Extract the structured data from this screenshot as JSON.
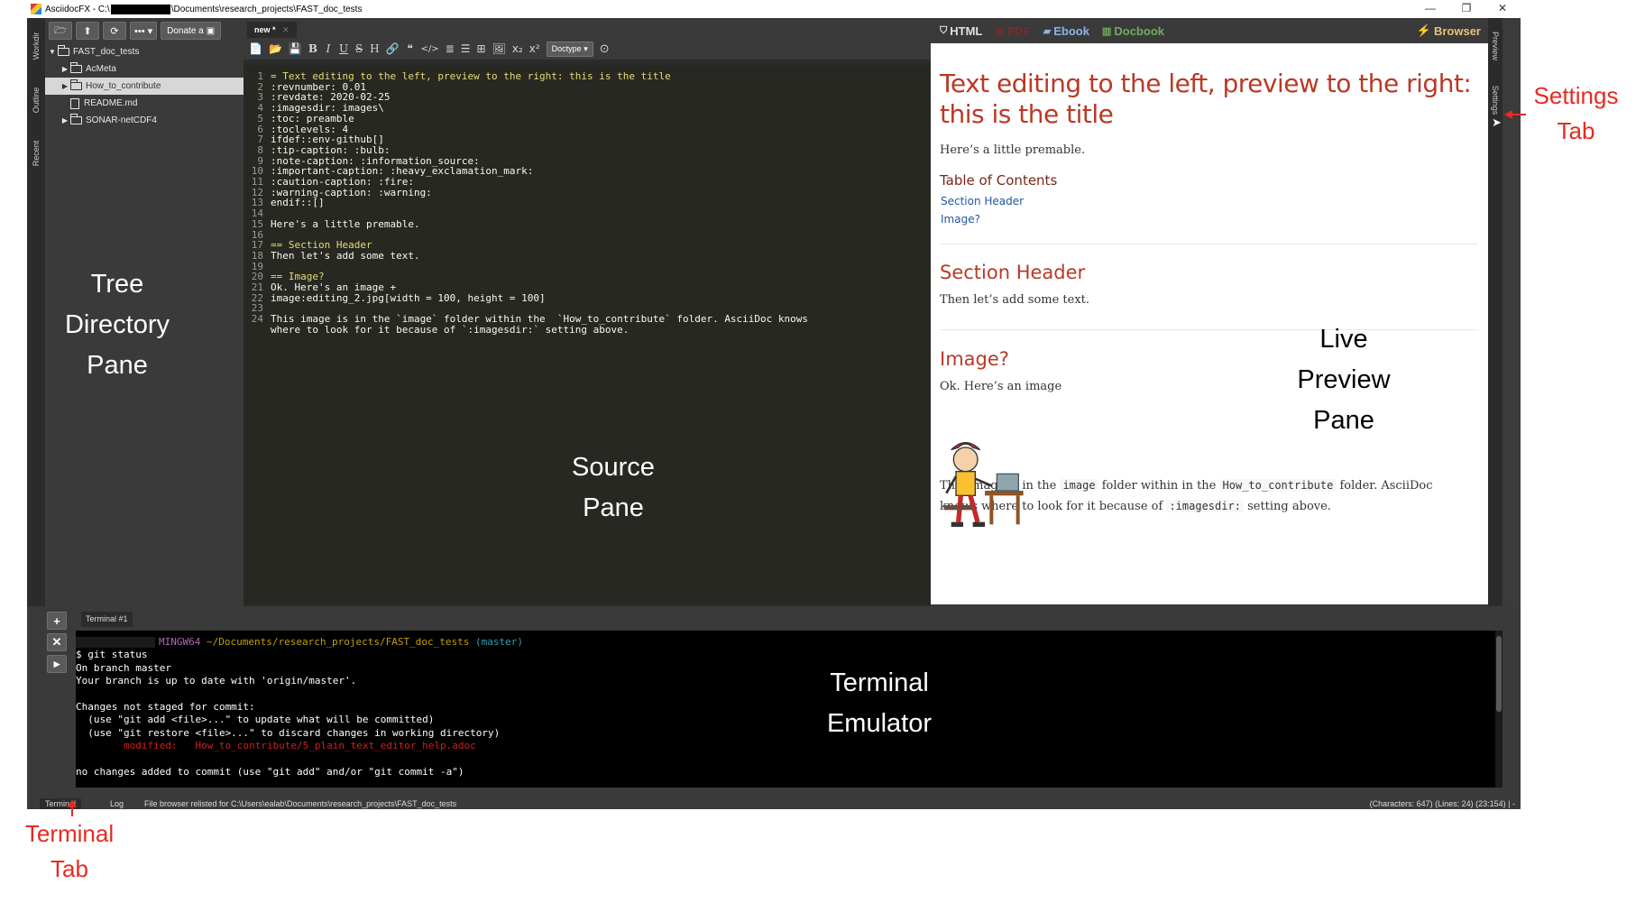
{
  "window": {
    "title_prefix": "AsciidocFX - C:\\",
    "title_suffix": "\\Documents\\research_projects\\FAST_doc_tests",
    "minimize": "—",
    "restore": "❐",
    "close": "✕"
  },
  "left_tabs": [
    "Workdir",
    "Outline",
    "Recent"
  ],
  "tree_toolbar": {
    "donate_label": "Donate a"
  },
  "tree": [
    {
      "label": "FAST_doc_tests",
      "arrow": "▼",
      "kind": "folder"
    },
    {
      "label": "AcMeta",
      "arrow": "▶",
      "kind": "folder"
    },
    {
      "label": "How_to_contribute",
      "arrow": "▶",
      "kind": "folder",
      "selected": true
    },
    {
      "label": "README.md",
      "arrow": "",
      "kind": "file"
    },
    {
      "label": "SONAR-netCDF4",
      "arrow": "▶",
      "kind": "folder"
    }
  ],
  "editor": {
    "tab_label": "new *",
    "tab_close": "✕",
    "doctype_label": "Doctype",
    "format_icons": [
      "📄",
      "📂",
      "💾",
      "B",
      "I",
      "U",
      "S",
      "H",
      "🔗",
      "❝",
      "</>",
      "≣",
      "☰",
      "⊞",
      "🖼",
      "x₂",
      "x²"
    ],
    "lines": [
      {
        "num": "1",
        "text": "= Text editing to the left, preview to the right: this is the title",
        "cls": "src-y"
      },
      {
        "num": "2",
        "text": ":revnumber: 0.01",
        "cls": "src-w"
      },
      {
        "num": "3",
        "text": ":revdate: 2020-02-25",
        "cls": "src-w"
      },
      {
        "num": "4",
        "text": ":imagesdir: images\\",
        "cls": "src-w"
      },
      {
        "num": "5",
        "text": ":toc: preamble",
        "cls": "src-w"
      },
      {
        "num": "6",
        "text": ":toclevels: 4",
        "cls": "src-w"
      },
      {
        "num": "7",
        "text": "ifdef::env-github[]",
        "cls": "src-w"
      },
      {
        "num": "8",
        "text": ":tip-caption: :bulb:",
        "cls": "src-w"
      },
      {
        "num": "9",
        "text": ":note-caption: :information_source:",
        "cls": "src-w"
      },
      {
        "num": "10",
        "text": ":important-caption: :heavy_exclamation_mark:",
        "cls": "src-w"
      },
      {
        "num": "11",
        "text": ":caution-caption: :fire:",
        "cls": "src-w"
      },
      {
        "num": "12",
        "text": ":warning-caption: :warning:",
        "cls": "src-w"
      },
      {
        "num": "13",
        "text": "endif::[]",
        "cls": "src-w"
      },
      {
        "num": "14",
        "text": "",
        "cls": "src-w"
      },
      {
        "num": "15",
        "text": "Here's a little premable.",
        "cls": "src-w"
      },
      {
        "num": "16",
        "text": "",
        "cls": "src-w"
      },
      {
        "num": "17",
        "text": "== Section Header",
        "cls": "src-y"
      },
      {
        "num": "18",
        "text": "Then let's add some text.",
        "cls": "src-w"
      },
      {
        "num": "19",
        "text": "",
        "cls": "src-w"
      },
      {
        "num": "20",
        "text": "== Image?",
        "cls": "src-y"
      },
      {
        "num": "21",
        "text": "Ok. Here's an image +",
        "cls": "src-w"
      },
      {
        "num": "22",
        "text": "image:editing_2.jpg[width = 100, height = 100]",
        "cls": "src-w"
      },
      {
        "num": "23",
        "text": "",
        "cls": "src-w"
      },
      {
        "num": "24",
        "text": "This image is in the `image` folder within the  `How_to_contribute` folder. AsciiDoc knows",
        "cls": "src-w"
      },
      {
        "num": "",
        "text": "where to look for it because of `:imagesdir:` setting above.",
        "cls": "src-w"
      }
    ]
  },
  "preview_header": {
    "html": "HTML",
    "pdf": "PDF",
    "ebook": "Ebook",
    "docbook": "Docbook",
    "browser": "Browser"
  },
  "right_tabs": [
    "Preview",
    "Settings"
  ],
  "preview": {
    "title": "Text editing to the left, preview to the right: this is the title",
    "premable": "Here’s a little premable.",
    "toc_title": "Table of Contents",
    "toc_items": [
      "Section Header",
      "Image?"
    ],
    "section1_title": "Section Header",
    "section1_text": "Then let’s add some text.",
    "section2_title": "Image?",
    "section2_text": "Ok. Here’s an image",
    "final_p1": "This image is in the",
    "final_code1": "image",
    "final_p2": "folder within in the",
    "final_code2": "How_to_contribute",
    "final_p3": "folder. AsciiDoc",
    "final_p4": "knows where to look for it because of",
    "final_code3": ":imagesdir:",
    "final_p5": "setting above."
  },
  "terminal": {
    "tab_label": "Terminal #1",
    "lines": [
      {
        "text": "MINGW64 ~/Documents/research_projects/FAST_doc_tests",
        "extra": " (master)",
        "cls": "prompt"
      },
      {
        "text": "$ git status",
        "cls": "w"
      },
      {
        "text": "On branch master",
        "cls": "w"
      },
      {
        "text": "Your branch is up to date with 'origin/master'.",
        "cls": "w"
      },
      {
        "text": "",
        "cls": "w"
      },
      {
        "text": "Changes not staged for commit:",
        "cls": "w"
      },
      {
        "text": "  (use \"git add <file>...\" to update what will be committed)",
        "cls": "w"
      },
      {
        "text": "  (use \"git restore <file>...\" to discard changes in working directory)",
        "cls": "w"
      },
      {
        "text": "        modified:   How_to_contribute/5_plain_text_editor_help.adoc",
        "cls": "red"
      },
      {
        "text": "",
        "cls": "w"
      },
      {
        "text": "no changes added to commit (use \"git add\" and/or \"git commit -a\")",
        "cls": "w"
      }
    ]
  },
  "statusbar": {
    "terminal_tab": "Terminal",
    "log_tab": "Log",
    "message": "File browser relisted for C:\\Users\\ealab\\Documents\\research_projects\\FAST_doc_tests",
    "stats": "(Characters: 647) (Lines: 24) (23:154) | -"
  },
  "annotations": {
    "tree": [
      "Tree",
      "Directory",
      "Pane"
    ],
    "source": [
      "Source",
      "Pane"
    ],
    "live": [
      "Live",
      "Preview",
      "Pane"
    ],
    "terminal": [
      "Terminal",
      "Emulator"
    ],
    "settings_tab": [
      "Settings",
      "Tab"
    ],
    "terminal_tab": [
      "Terminal",
      "Tab"
    ]
  },
  "colors": {
    "app_bg": "#3b3b3b",
    "source_bg": "#272822",
    "preview_heading": "#ba3925",
    "link": "#2156a5",
    "annotation_red": "#e52b22"
  }
}
